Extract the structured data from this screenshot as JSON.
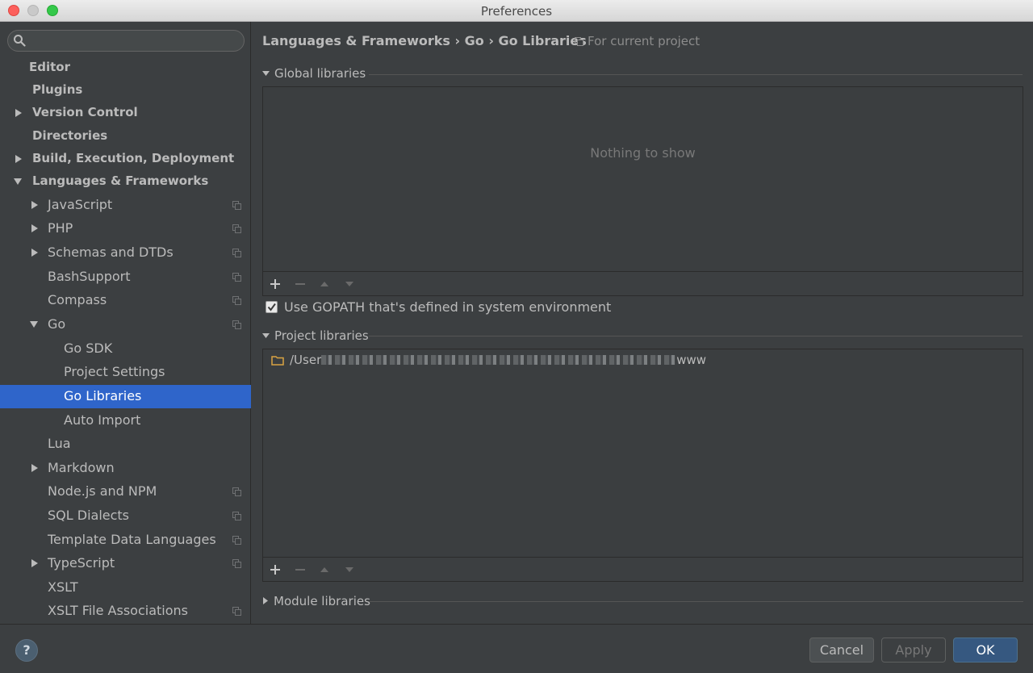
{
  "window": {
    "title": "Preferences"
  },
  "sidebar": {
    "search": {
      "value": "",
      "placeholder": ""
    },
    "items": [
      {
        "label": "Editor"
      },
      {
        "label": "Plugins"
      },
      {
        "label": "Version Control"
      },
      {
        "label": "Directories"
      },
      {
        "label": "Build, Execution, Deployment"
      },
      {
        "label": "Languages & Frameworks"
      },
      {
        "label": "JavaScript"
      },
      {
        "label": "PHP"
      },
      {
        "label": "Schemas and DTDs"
      },
      {
        "label": "BashSupport"
      },
      {
        "label": "Compass"
      },
      {
        "label": "Go"
      },
      {
        "label": "Go SDK"
      },
      {
        "label": "Project Settings"
      },
      {
        "label": "Go Libraries"
      },
      {
        "label": "Auto Import"
      },
      {
        "label": "Lua"
      },
      {
        "label": "Markdown"
      },
      {
        "label": "Node.js and NPM"
      },
      {
        "label": "SQL Dialects"
      },
      {
        "label": "Template Data Languages"
      },
      {
        "label": "TypeScript"
      },
      {
        "label": "XSLT"
      },
      {
        "label": "XSLT File Associations"
      }
    ]
  },
  "main": {
    "breadcrumb": "Languages & Frameworks › Go › Go Libraries",
    "scope_label": "For current project",
    "global_libraries": {
      "header": "Global libraries",
      "empty_text": "Nothing to show"
    },
    "use_gopath": {
      "label": "Use GOPATH that's defined in system environment",
      "checked": true
    },
    "project_libraries": {
      "header": "Project libraries",
      "entry_prefix": "/User",
      "entry_suffix": "www"
    },
    "module_libraries": {
      "header": "Module libraries"
    }
  },
  "footer": {
    "help_label": "?",
    "cancel_label": "Cancel",
    "apply_label": "Apply",
    "ok_label": "OK"
  },
  "colors": {
    "selection": "#2f65ca",
    "ok_button": "#365880"
  }
}
